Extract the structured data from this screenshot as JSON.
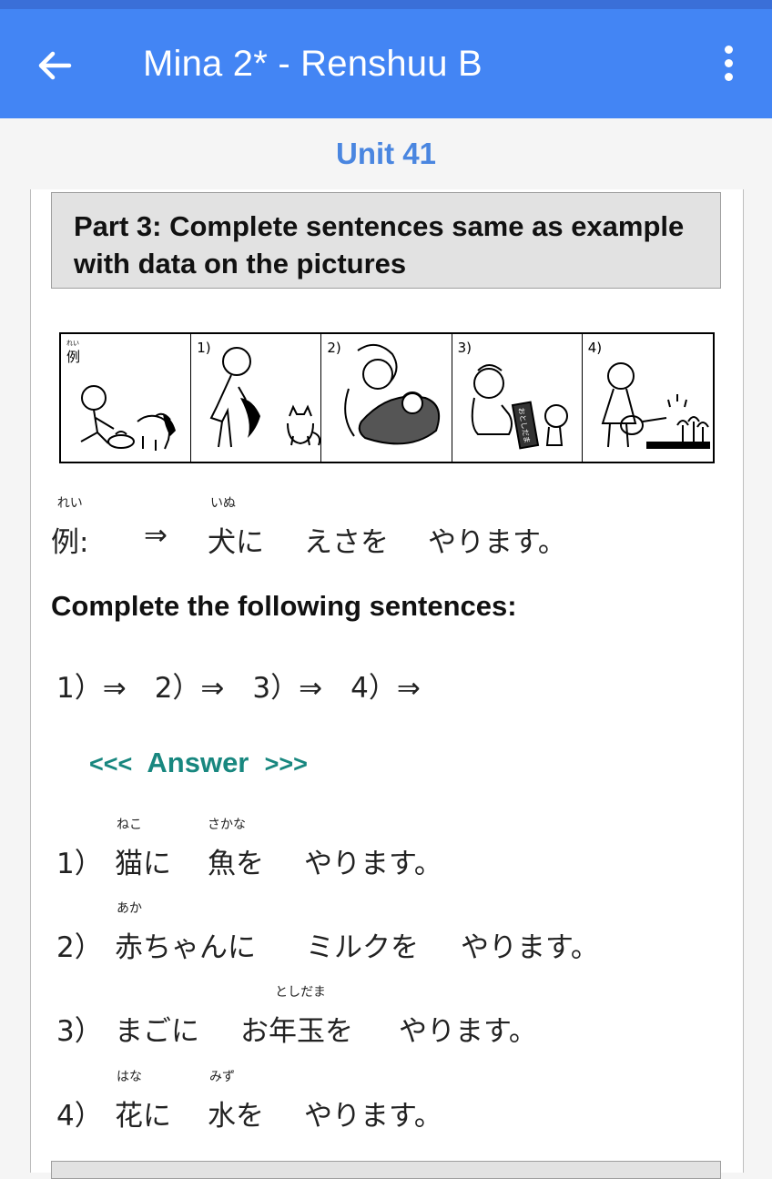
{
  "appbar": {
    "title": "Mina 2* - Renshuu B",
    "back_icon": "arrow-back-icon",
    "menu_icon": "more-vert-icon"
  },
  "unit": {
    "title": "Unit 41"
  },
  "part": {
    "title": "Part 3: Complete sentences same as example with data on the pictures"
  },
  "pictures": {
    "panels": [
      {
        "label": "例",
        "ruby": "れい"
      },
      {
        "label": "1)"
      },
      {
        "label": "2)"
      },
      {
        "label": "3)"
      },
      {
        "label": "4)"
      }
    ],
    "panel3_sign": "おとしだま"
  },
  "example": {
    "label": "例",
    "label_ruby": "れい",
    "colon": ":",
    "arrow": "⇒",
    "w1": "犬に",
    "w1_ruby": "いぬ",
    "w2": "えさを",
    "w3": "やります。"
  },
  "instruction": "Complete the following sentences:",
  "blanks": "1）⇒　2）⇒　3）⇒　4）⇒",
  "answer_toggle": {
    "left": "<<<",
    "label": "Answer",
    "right": ">>>"
  },
  "answers": [
    {
      "num": "1）",
      "w1": "猫に",
      "w1_ruby": "ねこ",
      "w2": "魚を",
      "w2_ruby": "さかな",
      "w3": "やります。"
    },
    {
      "num": "2）",
      "w1": "赤ちゃんに",
      "w1_ruby": "あか",
      "w2": "ミルクを",
      "w3": "やります。"
    },
    {
      "num": "3）",
      "w1": "まごに",
      "w2": "お年玉を",
      "w2_ruby": "としだま",
      "w3": "やります。"
    },
    {
      "num": "4）",
      "w1": "花に",
      "w1_ruby": "はな",
      "w2": "水を",
      "w2_ruby": "みず",
      "w3": "やります。"
    }
  ]
}
